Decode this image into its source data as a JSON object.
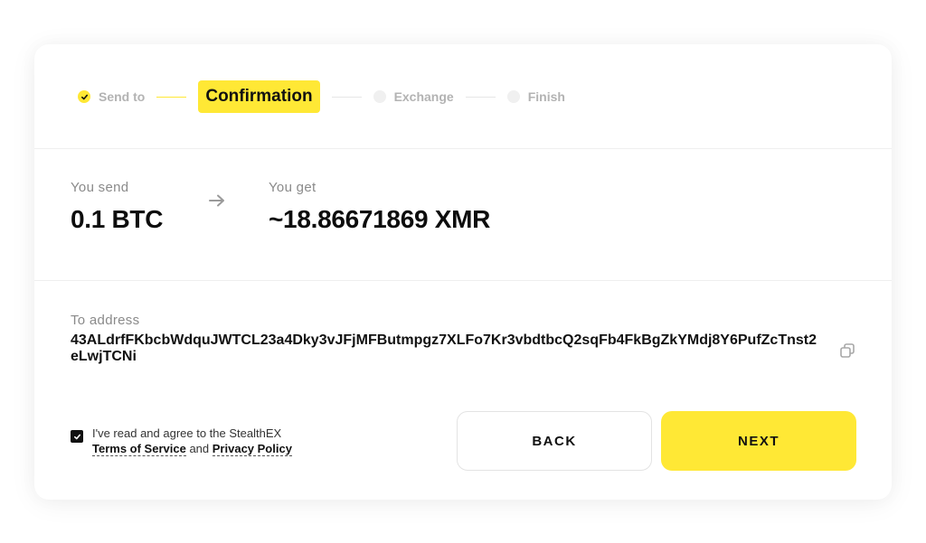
{
  "stepper": {
    "steps": [
      {
        "label": "Send to",
        "state": "done"
      },
      {
        "label": "Confirmation",
        "state": "active"
      },
      {
        "label": "Exchange",
        "state": "pending"
      },
      {
        "label": "Finish",
        "state": "pending"
      }
    ]
  },
  "summary": {
    "send_label": "You send",
    "send_amount": "0.1 BTC",
    "get_label": "You get",
    "get_amount": "~18.86671869 XMR",
    "arrow_icon": "arrow-right-icon"
  },
  "address": {
    "label": "To address",
    "value": "43ALdrfFKbcbWdquJWTCL23a4Dky3vJFjMFButmpgz7XLFo7Kr3vbdtbcQ2sqFb4FkBgZkYMdj8Y6PufZcTnst2eLwjTCNi",
    "copy_icon": "copy-icon"
  },
  "agreement": {
    "checked": true,
    "text_prefix": "I've read and agree to the StealthEX",
    "terms_label": "Terms of Service",
    "conjunction": "and",
    "privacy_label": "Privacy Policy"
  },
  "buttons": {
    "back_label": "BACK",
    "next_label": "NEXT"
  },
  "colors": {
    "accent": "#ffe835",
    "text": "#111111",
    "muted": "#8a8a8a"
  }
}
